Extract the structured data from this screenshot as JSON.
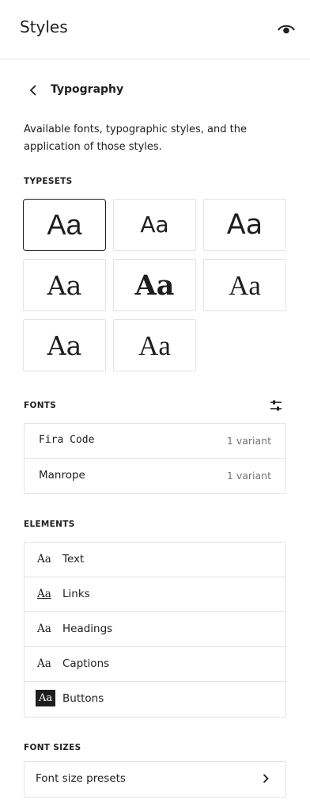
{
  "header": {
    "title": "Styles",
    "preview_icon": "eye-icon"
  },
  "nav": {
    "back_icon": "chevron-left-icon",
    "title": "Typography"
  },
  "description": "Available fonts, typographic styles, and the application of those styles.",
  "typesets": {
    "caption": "TYPESETS",
    "items": [
      {
        "label": "Aa",
        "selected": true
      },
      {
        "label": "Aa",
        "selected": false
      },
      {
        "label": "Aa",
        "selected": false
      },
      {
        "label": "Aa",
        "selected": false
      },
      {
        "label": "Aa",
        "selected": false
      },
      {
        "label": "Aa",
        "selected": false
      },
      {
        "label": "Aa",
        "selected": false
      },
      {
        "label": "Aa",
        "selected": false
      }
    ]
  },
  "fonts": {
    "caption": "FONTS",
    "manage_icon": "sliders-icon",
    "items": [
      {
        "name": "Fira Code",
        "variants": "1 variant"
      },
      {
        "name": "Manrope",
        "variants": "1 variant"
      }
    ]
  },
  "elements": {
    "caption": "ELEMENTS",
    "items": [
      {
        "preview": "Aa",
        "label": "Text"
      },
      {
        "preview": "Aa",
        "label": "Links"
      },
      {
        "preview": "Aa",
        "label": "Headings"
      },
      {
        "preview": "Aa",
        "label": "Captions"
      },
      {
        "preview": "Aa",
        "label": "Buttons"
      }
    ]
  },
  "font_sizes": {
    "caption": "FONT SIZES",
    "presets_label": "Font size presets",
    "chevron_icon": "chevron-right-icon"
  }
}
